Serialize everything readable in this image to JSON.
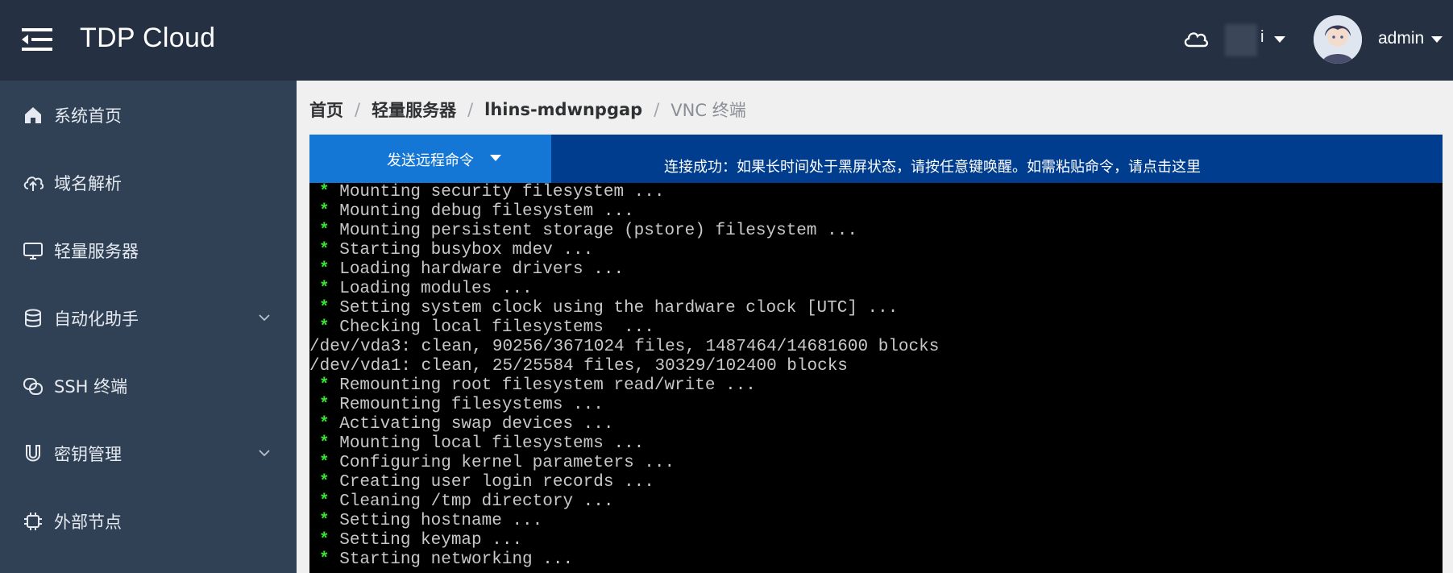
{
  "header": {
    "app_title": "TDP Cloud",
    "region_label": "i",
    "user_name": "admin"
  },
  "sidebar": {
    "items": [
      {
        "label": "系统首页",
        "icon": "home-icon",
        "expandable": false
      },
      {
        "label": "域名解析",
        "icon": "cloud-upload-icon",
        "expandable": false
      },
      {
        "label": "轻量服务器",
        "icon": "monitor-icon",
        "expandable": false
      },
      {
        "label": "自动化助手",
        "icon": "database-icon",
        "expandable": true
      },
      {
        "label": "SSH 终端",
        "icon": "link-icon",
        "expandable": false
      },
      {
        "label": "密钥管理",
        "icon": "magnet-icon",
        "expandable": true
      },
      {
        "label": "外部节点",
        "icon": "chip-icon",
        "expandable": false
      }
    ]
  },
  "breadcrumb": {
    "items": [
      "首页",
      "轻量服务器",
      "lhins-mdwnpgap"
    ],
    "current": "VNC 终端",
    "separator": "/"
  },
  "vnc": {
    "send_command_label": "发送远程命令",
    "status_message": "连接成功：如果长时间处于黑屏状态，请按任意键唤醒。如需粘贴命令，请点击这里"
  },
  "terminal": {
    "lines": [
      {
        "star": "*",
        "text": " Mounting security filesystem ..."
      },
      {
        "star": "*",
        "text": " Mounting debug filesystem ..."
      },
      {
        "star": "*",
        "text": " Mounting persistent storage (pstore) filesystem ..."
      },
      {
        "star": "*",
        "text": " Starting busybox mdev ..."
      },
      {
        "star": "*",
        "text": " Loading hardware drivers ..."
      },
      {
        "star": "*",
        "text": " Loading modules ..."
      },
      {
        "star": "*",
        "text": " Setting system clock using the hardware clock [UTC] ..."
      },
      {
        "star": "*",
        "text": " Checking local filesystems  ..."
      },
      {
        "star": "",
        "text": "/dev/vda3: clean, 90256/3671024 files, 1487464/14681600 blocks"
      },
      {
        "star": "",
        "text": "/dev/vda1: clean, 25/25584 files, 30329/102400 blocks"
      },
      {
        "star": "*",
        "text": " Remounting root filesystem read/write ..."
      },
      {
        "star": "*",
        "text": " Remounting filesystems ..."
      },
      {
        "star": "*",
        "text": " Activating swap devices ..."
      },
      {
        "star": "*",
        "text": " Mounting local filesystems ..."
      },
      {
        "star": "*",
        "text": " Configuring kernel parameters ..."
      },
      {
        "star": "*",
        "text": " Creating user login records ..."
      },
      {
        "star": "*",
        "text": " Cleaning /tmp directory ..."
      },
      {
        "star": "*",
        "text": " Setting hostname ..."
      },
      {
        "star": "*",
        "text": " Setting keymap ..."
      },
      {
        "star": "*",
        "text": " Starting networking ..."
      }
    ]
  },
  "colors": {
    "header_bg": "#253143",
    "sidebar_bg": "#304156",
    "send_button_bg": "#1477d6",
    "status_bar_bg": "#003d8f",
    "terminal_star": "#35e135"
  }
}
